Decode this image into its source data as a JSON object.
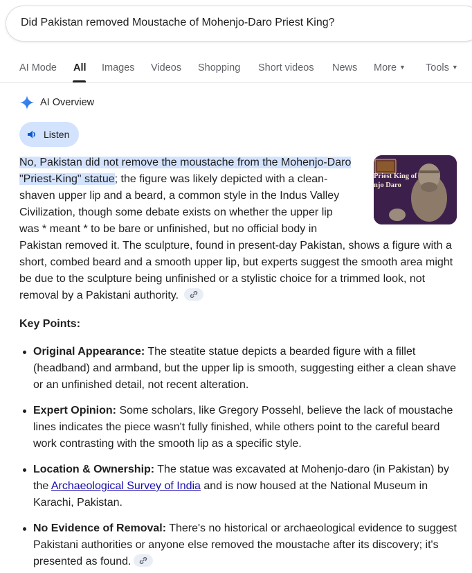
{
  "search": {
    "query": "Did Pakistan removed Moustache of Mohenjo-Daro Priest King?"
  },
  "tabs": [
    {
      "label": "AI Mode"
    },
    {
      "label": "All"
    },
    {
      "label": "Images"
    },
    {
      "label": "Videos"
    },
    {
      "label": "Shopping"
    },
    {
      "label": "Short videos"
    },
    {
      "label": "News"
    },
    {
      "label": "More"
    },
    {
      "label": "Tools"
    }
  ],
  "ai_overview": {
    "title": "AI Overview",
    "listen_label": "Listen",
    "highlight_text": "No, Pakistan did not remove the moustache from the Mohenjo-Daro \"Priest-King\" statue",
    "body_text": "; the figure was likely depicted with a clean-shaven upper lip and a beard, a common style in the Indus Valley Civilization, though some debate exists on whether the upper lip was * meant * to be bare or unfinished, but no official body in Pakistan removed it. The sculpture, found in present-day Pakistan, shows a figure with a short, combed beard and a smooth upper lip, but experts suggest the smooth area might be due to the sculpture being unfinished or a stylistic choice for a trimmed look, not removal by a Pakistani authority.",
    "thumbnail_caption_line1": "Priest King of",
    "thumbnail_caption_line2": "njo Daro",
    "key_points_title": "Key Points:",
    "key_points": [
      {
        "title": "Original Appearance:",
        "text": " The steatite statue depicts a bearded figure with a fillet (headband) and armband, but the upper lip is smooth, suggesting either a clean shave or an unfinished detail, not recent alteration."
      },
      {
        "title": "Expert Opinion:",
        "text": " Some scholars, like Gregory Possehl, believe the lack of moustache lines indicates the piece wasn't fully finished, while others point to the careful beard work contrasting with the smooth lip as a specific style."
      },
      {
        "title": "Location & Ownership:",
        "text_before": " The statue was excavated at Mohenjo-daro (in Pakistan) by the ",
        "link": "Archaeological Survey of India",
        "text_after": " and is now housed at the National Museum in Karachi, Pakistan."
      },
      {
        "title": "No Evidence of Removal:",
        "text": " There's no historical or archaeological evidence to suggest Pakistani authorities or anyone else removed the moustache after its discovery; it's presented as found."
      }
    ]
  },
  "colors": {
    "accent": "#d3e3fd",
    "link": "#1a0dab",
    "text": "#1f1f1f",
    "muted": "#5f6368"
  },
  "icons": [
    "sparkle-icon",
    "speaker-icon",
    "link-icon",
    "chevron-down-icon"
  ]
}
